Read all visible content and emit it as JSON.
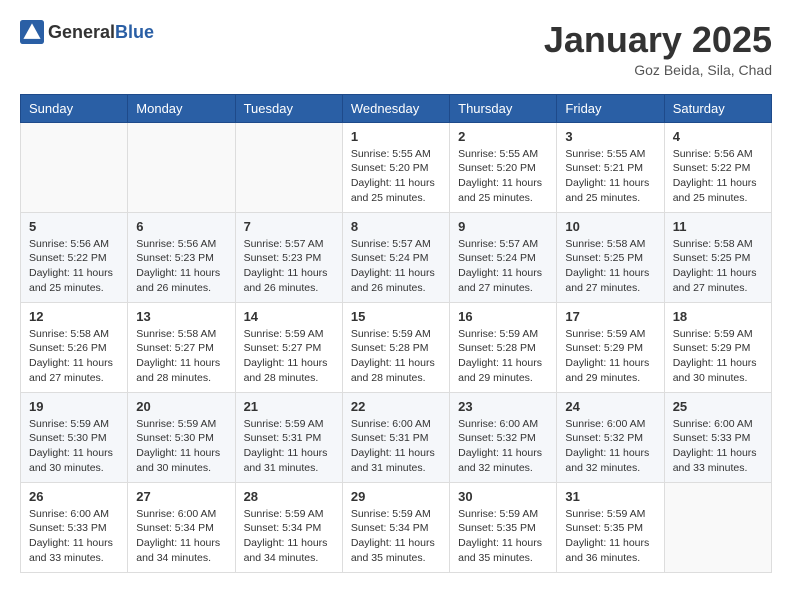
{
  "logo": {
    "general": "General",
    "blue": "Blue"
  },
  "header": {
    "month_year": "January 2025",
    "location": "Goz Beida, Sila, Chad"
  },
  "days_of_week": [
    "Sunday",
    "Monday",
    "Tuesday",
    "Wednesday",
    "Thursday",
    "Friday",
    "Saturday"
  ],
  "weeks": [
    [
      {
        "day": "",
        "info": ""
      },
      {
        "day": "",
        "info": ""
      },
      {
        "day": "",
        "info": ""
      },
      {
        "day": "1",
        "info": "Sunrise: 5:55 AM\nSunset: 5:20 PM\nDaylight: 11 hours and 25 minutes."
      },
      {
        "day": "2",
        "info": "Sunrise: 5:55 AM\nSunset: 5:20 PM\nDaylight: 11 hours and 25 minutes."
      },
      {
        "day": "3",
        "info": "Sunrise: 5:55 AM\nSunset: 5:21 PM\nDaylight: 11 hours and 25 minutes."
      },
      {
        "day": "4",
        "info": "Sunrise: 5:56 AM\nSunset: 5:22 PM\nDaylight: 11 hours and 25 minutes."
      }
    ],
    [
      {
        "day": "5",
        "info": "Sunrise: 5:56 AM\nSunset: 5:22 PM\nDaylight: 11 hours and 25 minutes."
      },
      {
        "day": "6",
        "info": "Sunrise: 5:56 AM\nSunset: 5:23 PM\nDaylight: 11 hours and 26 minutes."
      },
      {
        "day": "7",
        "info": "Sunrise: 5:57 AM\nSunset: 5:23 PM\nDaylight: 11 hours and 26 minutes."
      },
      {
        "day": "8",
        "info": "Sunrise: 5:57 AM\nSunset: 5:24 PM\nDaylight: 11 hours and 26 minutes."
      },
      {
        "day": "9",
        "info": "Sunrise: 5:57 AM\nSunset: 5:24 PM\nDaylight: 11 hours and 27 minutes."
      },
      {
        "day": "10",
        "info": "Sunrise: 5:58 AM\nSunset: 5:25 PM\nDaylight: 11 hours and 27 minutes."
      },
      {
        "day": "11",
        "info": "Sunrise: 5:58 AM\nSunset: 5:25 PM\nDaylight: 11 hours and 27 minutes."
      }
    ],
    [
      {
        "day": "12",
        "info": "Sunrise: 5:58 AM\nSunset: 5:26 PM\nDaylight: 11 hours and 27 minutes."
      },
      {
        "day": "13",
        "info": "Sunrise: 5:58 AM\nSunset: 5:27 PM\nDaylight: 11 hours and 28 minutes."
      },
      {
        "day": "14",
        "info": "Sunrise: 5:59 AM\nSunset: 5:27 PM\nDaylight: 11 hours and 28 minutes."
      },
      {
        "day": "15",
        "info": "Sunrise: 5:59 AM\nSunset: 5:28 PM\nDaylight: 11 hours and 28 minutes."
      },
      {
        "day": "16",
        "info": "Sunrise: 5:59 AM\nSunset: 5:28 PM\nDaylight: 11 hours and 29 minutes."
      },
      {
        "day": "17",
        "info": "Sunrise: 5:59 AM\nSunset: 5:29 PM\nDaylight: 11 hours and 29 minutes."
      },
      {
        "day": "18",
        "info": "Sunrise: 5:59 AM\nSunset: 5:29 PM\nDaylight: 11 hours and 30 minutes."
      }
    ],
    [
      {
        "day": "19",
        "info": "Sunrise: 5:59 AM\nSunset: 5:30 PM\nDaylight: 11 hours and 30 minutes."
      },
      {
        "day": "20",
        "info": "Sunrise: 5:59 AM\nSunset: 5:30 PM\nDaylight: 11 hours and 30 minutes."
      },
      {
        "day": "21",
        "info": "Sunrise: 5:59 AM\nSunset: 5:31 PM\nDaylight: 11 hours and 31 minutes."
      },
      {
        "day": "22",
        "info": "Sunrise: 6:00 AM\nSunset: 5:31 PM\nDaylight: 11 hours and 31 minutes."
      },
      {
        "day": "23",
        "info": "Sunrise: 6:00 AM\nSunset: 5:32 PM\nDaylight: 11 hours and 32 minutes."
      },
      {
        "day": "24",
        "info": "Sunrise: 6:00 AM\nSunset: 5:32 PM\nDaylight: 11 hours and 32 minutes."
      },
      {
        "day": "25",
        "info": "Sunrise: 6:00 AM\nSunset: 5:33 PM\nDaylight: 11 hours and 33 minutes."
      }
    ],
    [
      {
        "day": "26",
        "info": "Sunrise: 6:00 AM\nSunset: 5:33 PM\nDaylight: 11 hours and 33 minutes."
      },
      {
        "day": "27",
        "info": "Sunrise: 6:00 AM\nSunset: 5:34 PM\nDaylight: 11 hours and 34 minutes."
      },
      {
        "day": "28",
        "info": "Sunrise: 5:59 AM\nSunset: 5:34 PM\nDaylight: 11 hours and 34 minutes."
      },
      {
        "day": "29",
        "info": "Sunrise: 5:59 AM\nSunset: 5:34 PM\nDaylight: 11 hours and 35 minutes."
      },
      {
        "day": "30",
        "info": "Sunrise: 5:59 AM\nSunset: 5:35 PM\nDaylight: 11 hours and 35 minutes."
      },
      {
        "day": "31",
        "info": "Sunrise: 5:59 AM\nSunset: 5:35 PM\nDaylight: 11 hours and 36 minutes."
      },
      {
        "day": "",
        "info": ""
      }
    ]
  ]
}
